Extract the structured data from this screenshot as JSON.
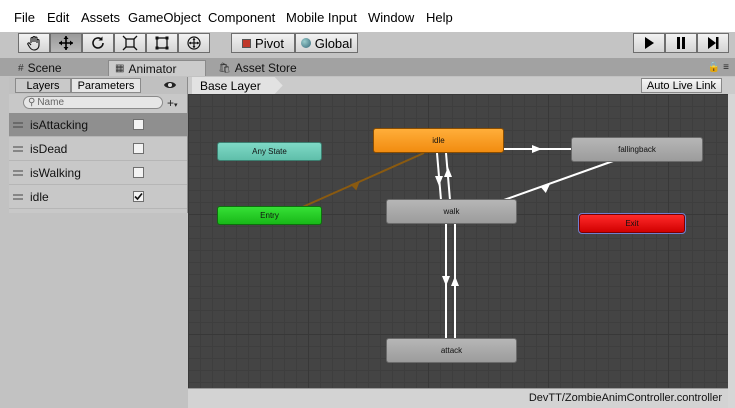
{
  "menu": [
    "File",
    "Edit",
    "Assets",
    "GameObject",
    "Component",
    "Mobile Input",
    "Window",
    "Help"
  ],
  "toolbar": {
    "pivot_label": "Pivot",
    "global_label": "Global"
  },
  "tabs": [
    {
      "label": "Scene"
    },
    {
      "label": "Animator"
    },
    {
      "label": "Asset Store"
    }
  ],
  "subtabs": {
    "layers": "Layers",
    "parameters": "Parameters"
  },
  "search": {
    "placeholder": "Name"
  },
  "parameters": [
    {
      "name": "isAttacking",
      "checked": false,
      "selected": true
    },
    {
      "name": "isDead",
      "checked": false,
      "selected": false
    },
    {
      "name": "isWalking",
      "checked": false,
      "selected": false
    },
    {
      "name": "idle",
      "checked": true,
      "selected": false
    }
  ],
  "breadcrumb": "Base Layer",
  "auto_live_link": "Auto Live Link",
  "states": {
    "any_state": "Any State",
    "entry": "Entry",
    "idle": "idle",
    "walk": "walk",
    "fallingback": "fallingback",
    "exit": "Exit",
    "attack": "attack"
  },
  "footer_path": "DevTT/ZombieAnimController.controller"
}
